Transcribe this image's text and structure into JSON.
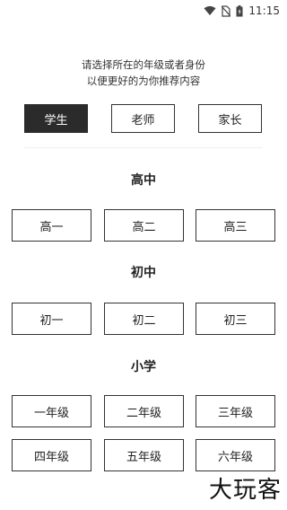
{
  "status_bar": {
    "time": "11:15",
    "icons": [
      "wifi-icon",
      "no-sim-icon",
      "battery-icon"
    ]
  },
  "prompt": {
    "line1": "请选择所在的年级或者身份",
    "line2": "以便更好的为你推荐内容"
  },
  "roles": [
    {
      "label": "学生",
      "selected": true
    },
    {
      "label": "老师",
      "selected": false
    },
    {
      "label": "家长",
      "selected": false
    }
  ],
  "sections": [
    {
      "title": "高中",
      "grades": [
        "高一",
        "高二",
        "高三"
      ]
    },
    {
      "title": "初中",
      "grades": [
        "初一",
        "初二",
        "初三"
      ]
    },
    {
      "title": "小学",
      "grades": [
        "一年级",
        "二年级",
        "三年级",
        "四年级",
        "五年级",
        "六年级"
      ]
    }
  ],
  "watermark": "大玩客"
}
